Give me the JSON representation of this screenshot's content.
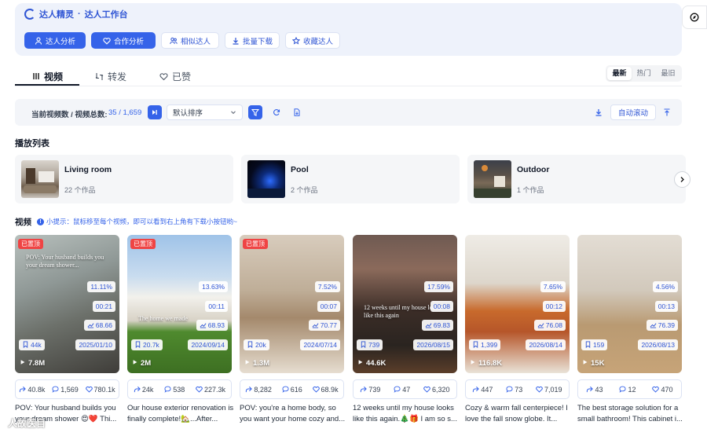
{
  "header": {
    "brand": "达人精灵",
    "separator": "·",
    "workspace": "达人工作台",
    "buttons": [
      {
        "label": "达人分析",
        "icon": "user-icon"
      },
      {
        "label": "合作分析",
        "icon": "heart-icon"
      },
      {
        "label": "相似达人",
        "icon": "users-icon"
      },
      {
        "label": "批量下载",
        "icon": "download-icon"
      },
      {
        "label": "收藏达人",
        "icon": "star-icon"
      }
    ]
  },
  "tabs": [
    {
      "label": "视频",
      "icon": "grid-icon",
      "active": true
    },
    {
      "label": "转发",
      "icon": "repost-icon",
      "active": false
    },
    {
      "label": "已赞",
      "icon": "like-icon",
      "active": false
    }
  ],
  "sort_toggle": [
    "最新",
    "热门",
    "最旧"
  ],
  "toolbar": {
    "count_label": "当前视频数 / 视频总数:",
    "count_value": "35 / 1,659",
    "sort_selected": "默认排序",
    "auto_scroll": "自动滚动"
  },
  "playlists": {
    "title": "播放列表",
    "items": [
      {
        "name": "Living room",
        "count": "22 个作品"
      },
      {
        "name": "Pool",
        "count": "2 个作品"
      },
      {
        "name": "Outdoor",
        "count": "1 个作品"
      }
    ]
  },
  "videos": {
    "title": "视频",
    "tip": "小提示：鼠标移至每个视频，即可以看到右上角有下载小按钮哟~",
    "items": [
      {
        "badge": "已置顶",
        "pct": "11.11%",
        "duration": "00:21",
        "score": "68.66",
        "saves": "44k",
        "date": "2025/01/10",
        "plays": "7.8M",
        "shares": "40.8k",
        "comments": "1,569",
        "likes": "780.1k",
        "title": "POV: Your husband builds you your dream shower 😍❤️ Thi...",
        "overlay": "POV: Your husband builds you your dream shower..."
      },
      {
        "badge": "已置顶",
        "pct": "13.63%",
        "duration": "00:11",
        "score": "68.93",
        "saves": "20.7k",
        "date": "2024/09/14",
        "plays": "2M",
        "shares": "24k",
        "comments": "538",
        "likes": "227.3k",
        "title": "Our house exterior renovation is finally complete!🏡...After...",
        "overlay": "The home we made"
      },
      {
        "badge": "已置顶",
        "pct": "7.52%",
        "duration": "00:07",
        "score": "70.77",
        "saves": "20k",
        "date": "2024/07/14",
        "plays": "1.3M",
        "shares": "8,282",
        "comments": "616",
        "likes": "68.9k",
        "title": "POV: you're a home body, so you want your home cozy and...",
        "overlay": ""
      },
      {
        "badge": "",
        "pct": "17.59%",
        "duration": "00:08",
        "score": "69.83",
        "saves": "739",
        "date": "2026/08/15",
        "plays": "44.6K",
        "shares": "739",
        "comments": "47",
        "likes": "6,320",
        "title": "12 weeks until my house looks like this again.🎄🎁 I am so s...",
        "overlay": "12 weeks until my house looks like this again"
      },
      {
        "badge": "",
        "pct": "7.65%",
        "duration": "00:12",
        "score": "76.08",
        "saves": "1,399",
        "date": "2026/08/14",
        "plays": "116.8K",
        "shares": "447",
        "comments": "73",
        "likes": "7,019",
        "title": "Cozy & warm fall centerpiece! I love the fall snow globe. It...",
        "overlay": ""
      },
      {
        "badge": "",
        "pct": "4.56%",
        "duration": "00:13",
        "score": "76.39",
        "saves": "159",
        "date": "2026/08/13",
        "plays": "15K",
        "shares": "43",
        "comments": "12",
        "likes": "470",
        "title": "The best storage solution for a small bathroom! This cabinet i...",
        "overlay": ""
      }
    ]
  },
  "watermark": "人故医目",
  "colors": {
    "accent": "#3563e9",
    "badge_red": "#ef4444",
    "panel": "#eef2fb"
  }
}
